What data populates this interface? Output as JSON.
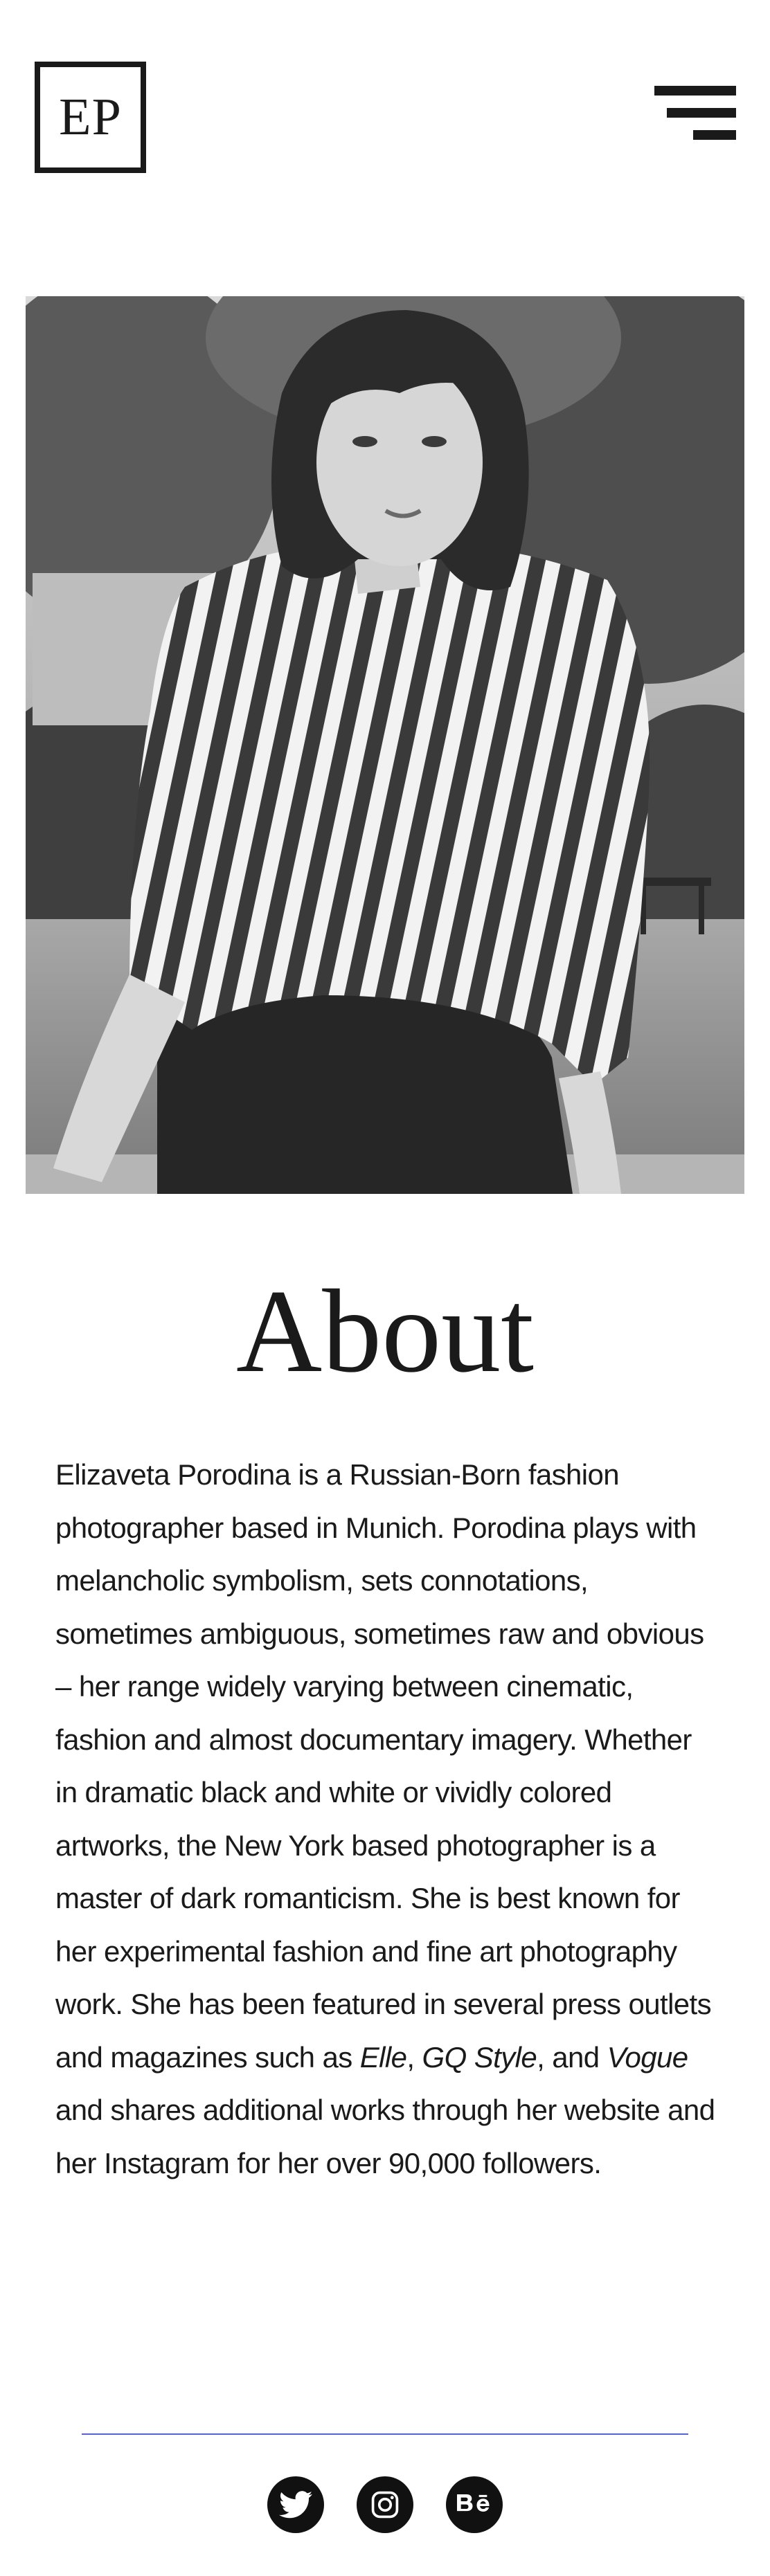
{
  "header": {
    "logo_text": "EP",
    "menu_icon": "hamburger-menu-icon"
  },
  "hero": {
    "image": "portrait-photo",
    "style": "black-and-white"
  },
  "about": {
    "title": "About",
    "body_part1": "Elizaveta Porodina is a Russian-Born fashion photographer based in Munich. Porodina plays with melancholic symbolism, sets connotations, sometimes ambiguous, sometimes raw and obvious – her range widely varying between cinematic, fashion and almost documentary imagery. Whether in dramatic black and white or vividly colored artworks, the New York based photographer is a master of dark romanticism. She is best known for her experimental fashion and fine art photography work. She has been featured in several press outlets and magazines such as ",
    "mag1": "Elle",
    "sep1": ", ",
    "mag2": "GQ Style",
    "sep2": ", and ",
    "mag3": "Vogue",
    "body_part2": " and shares additional works through her website and her Instagram for her over 90,000 followers."
  },
  "footer": {
    "divider_color": "#5560d9",
    "socials": [
      {
        "icon": "twitter-icon"
      },
      {
        "icon": "instagram-icon"
      },
      {
        "icon": "behance-icon"
      }
    ]
  }
}
